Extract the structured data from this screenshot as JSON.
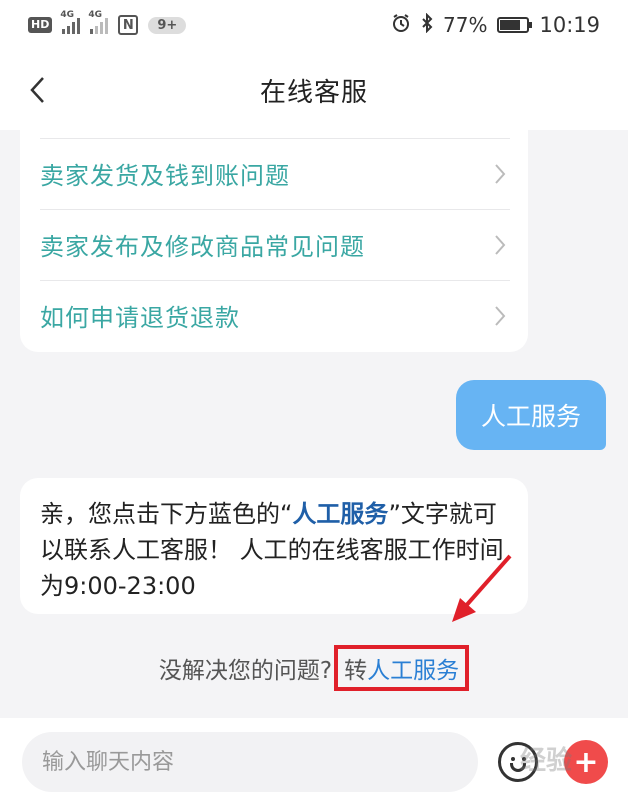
{
  "status_bar": {
    "hd": "HD",
    "net1": "4G",
    "net2": "4G",
    "nfc": "N",
    "notifications": "9+",
    "battery": "77%",
    "battery_level": 0.77,
    "time": "10:19"
  },
  "header": {
    "title": "在线客服"
  },
  "faq": {
    "items": [
      {
        "label": "卖家发货及钱到账问题"
      },
      {
        "label": "卖家发布及修改商品常见问题"
      },
      {
        "label": "如何申请退货退款"
      }
    ]
  },
  "user_message": {
    "text": "人工服务"
  },
  "bot_message": {
    "part1": "亲，您点击下方蓝色的",
    "quote_open": "“",
    "highlight": "人工服务",
    "quote_close": "”",
    "part2": "文字就可以联系人工客服！ 人工的在线客服工作时间为9:00-23:00"
  },
  "transfer": {
    "question": "没解决您的问题?",
    "prefix": "转",
    "link": "人工服务"
  },
  "input_bar": {
    "placeholder": "输入聊天内容"
  },
  "watermark": "经验",
  "colors": {
    "faq_text": "#3aa7a3",
    "user_bubble": "#67b4f3",
    "highlight": "#1f5fa8",
    "link": "#2a7fd4",
    "annotation_red": "#e0202a",
    "plus_button": "#f04b4b"
  }
}
